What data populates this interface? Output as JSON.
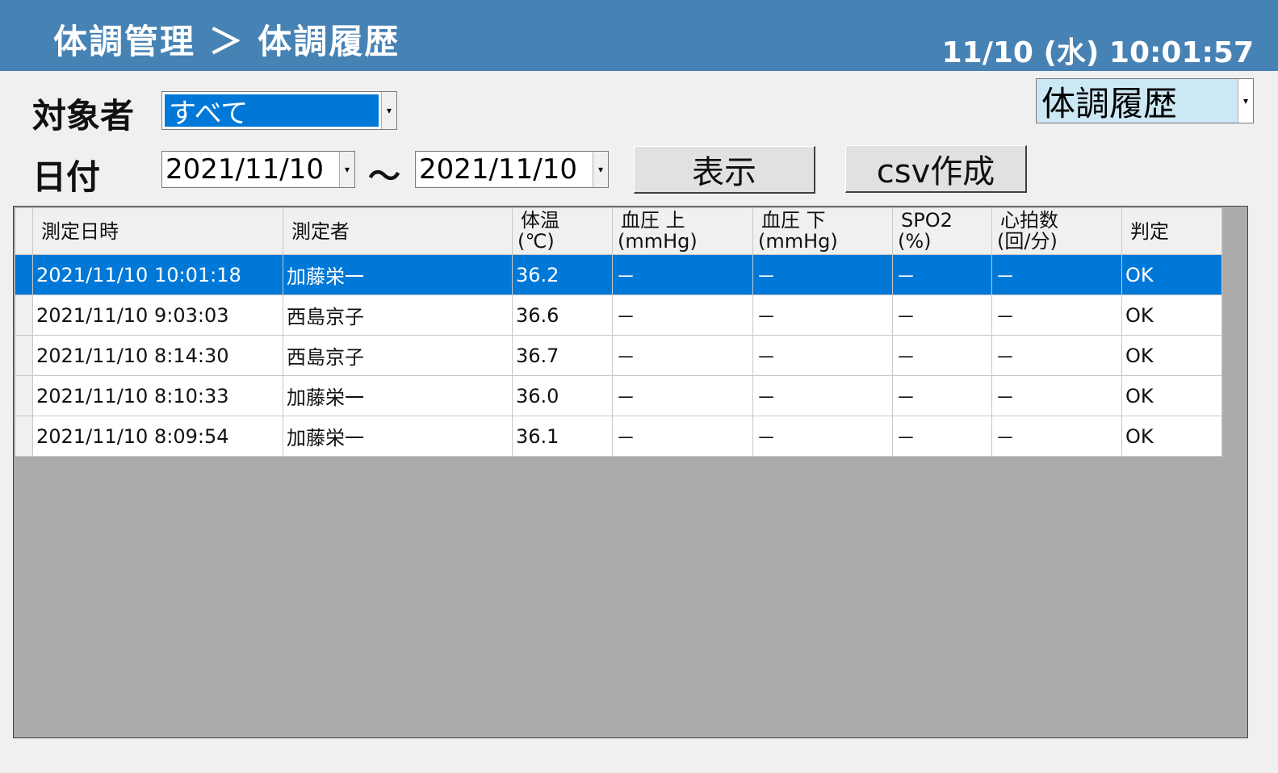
{
  "header": {
    "title": "体調管理 ＞ 体調履歴",
    "datetime": "11/10 (水)  10:01:57"
  },
  "view_select": {
    "value": "体調履歴"
  },
  "filters": {
    "subject_label": "対象者",
    "subject_value": "すべて",
    "date_label": "日付",
    "date_from": "2021/11/10",
    "range_separator": "～",
    "date_to": "2021/11/10"
  },
  "buttons": {
    "show": "表示",
    "csv": "csv作成"
  },
  "table": {
    "columns": [
      {
        "line1": "測定日時",
        "line2": ""
      },
      {
        "line1": "測定者",
        "line2": ""
      },
      {
        "line1": "体温",
        "line2": "(℃)"
      },
      {
        "line1": "血圧 上",
        "line2": "(mmHg)"
      },
      {
        "line1": "血圧 下",
        "line2": "(mmHg)"
      },
      {
        "line1": "SPO2",
        "line2": "(%)"
      },
      {
        "line1": "心拍数",
        "line2": "(回/分)"
      },
      {
        "line1": "判定",
        "line2": ""
      }
    ],
    "rows": [
      [
        "2021/11/10 10:01:18",
        "加藤栄一",
        "36.2",
        "－",
        "－",
        "－",
        "－",
        "OK"
      ],
      [
        "2021/11/10 9:03:03",
        "西島京子",
        "36.6",
        "－",
        "－",
        "－",
        "－",
        "OK"
      ],
      [
        "2021/11/10 8:14:30",
        "西島京子",
        "36.7",
        "－",
        "－",
        "－",
        "－",
        "OK"
      ],
      [
        "2021/11/10 8:10:33",
        "加藤栄一",
        "36.0",
        "－",
        "－",
        "－",
        "－",
        "OK"
      ],
      [
        "2021/11/10 8:09:54",
        "加藤栄一",
        "36.1",
        "－",
        "－",
        "－",
        "－",
        "OK"
      ]
    ],
    "selected_row": 0
  },
  "colors": {
    "title_bar": "#4682b4",
    "selection": "#0078d7",
    "view_select_bg": "#cce8f4",
    "grid_background": "#ababab"
  }
}
